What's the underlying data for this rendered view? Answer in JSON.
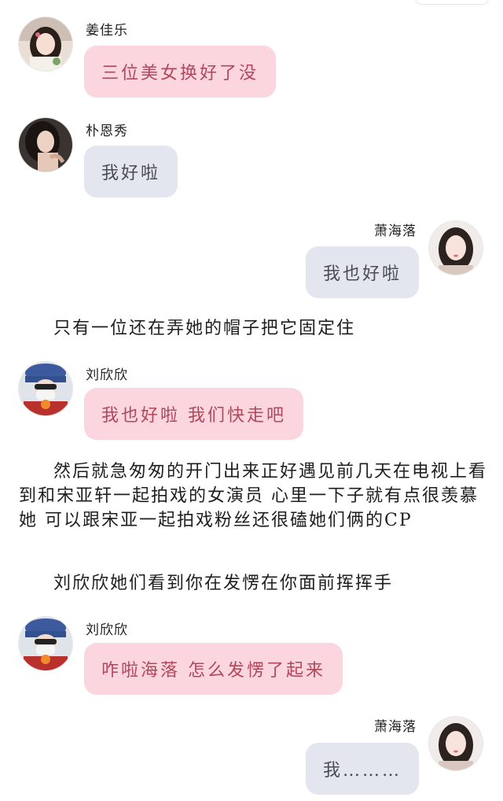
{
  "messages": [
    {
      "name": "姜佳乐",
      "text": "三位美女换好了没"
    },
    {
      "name": "朴恩秀",
      "text": "我好啦"
    },
    {
      "name": "萧海落",
      "text": "我也好啦"
    },
    {
      "name": "刘欣欣",
      "text": "我也好啦 我们快走吧"
    },
    {
      "name": "刘欣欣",
      "text": "咋啦海落 怎么发愣了起来"
    },
    {
      "name": "萧海落",
      "text": "我………"
    }
  ],
  "narration": [
    "只有一位还在弄她的帽子把它固定住",
    "然后就急匆匆的开门出来正好遇见前几天在电视上看到和宋亚轩一起拍戏的女演员 心里一下子就有点很羡慕她 可以跟宋亚一起拍戏粉丝还很磕她们俩的CP",
    "刘欣欣她们看到你在发愣在你面前挥挥手"
  ],
  "colors": {
    "pink_bubble": "#fcd6de",
    "pink_text": "#b2465a",
    "gray_bubble": "#e3e6ee",
    "gray_text": "#4a4c52"
  }
}
